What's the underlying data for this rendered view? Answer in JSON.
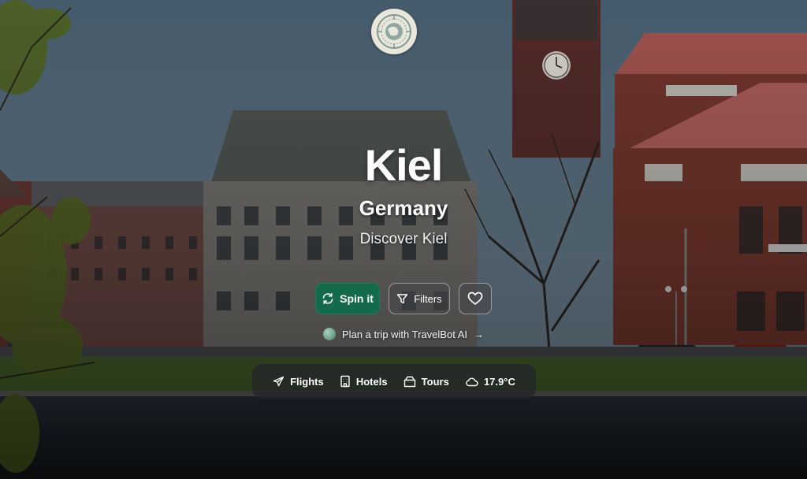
{
  "hero": {
    "city": "Kiel",
    "country": "Germany",
    "tagline": "Discover Kiel"
  },
  "actions": {
    "spin_label": "Spin it",
    "filters_label": "Filters",
    "favorite_icon": "heart-icon",
    "spin_icon": "refresh-icon",
    "filters_icon": "filter-icon"
  },
  "ai_link": {
    "label": "Plan a trip with TravelBot AI",
    "arrow": "→"
  },
  "bottom_bar": {
    "flights": "Flights",
    "hotels": "Hotels",
    "tours": "Tours",
    "weather": "17.9°C"
  },
  "colors": {
    "accent": "#146b4c",
    "logo_bg": "#e9e6da"
  }
}
